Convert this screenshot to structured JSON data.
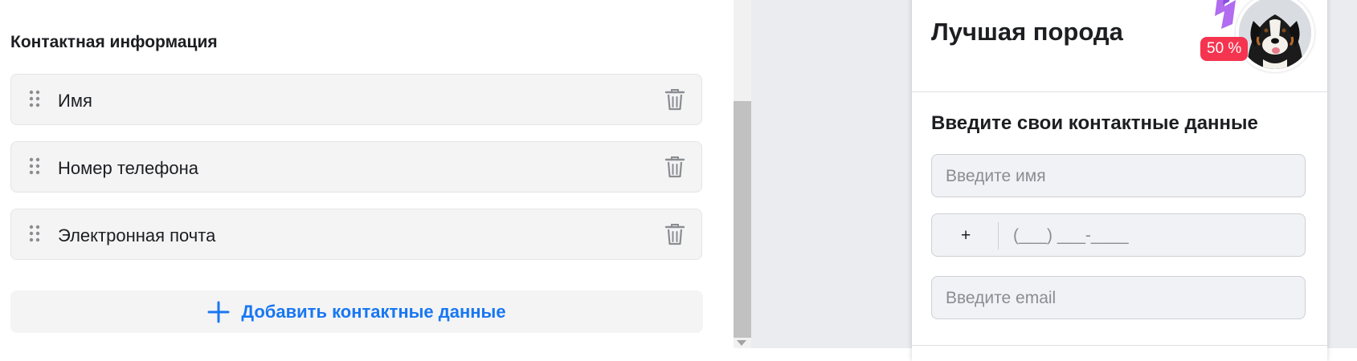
{
  "editor": {
    "section_title": "Контактная информация",
    "items": [
      {
        "label": "Имя"
      },
      {
        "label": "Номер телефона"
      },
      {
        "label": "Электронная почта"
      }
    ],
    "add_button_label": "Добавить контактные данные",
    "accent_color": "#1877f2"
  },
  "preview": {
    "title": "Лучшая порода",
    "badge": "50 %",
    "form_heading": "Введите свои контактные данные",
    "name_placeholder": "Введите имя",
    "phone_prefix": "+",
    "phone_mask": "(___) ___-____",
    "email_placeholder": "Введите email",
    "badge_color": "#f5344f"
  }
}
